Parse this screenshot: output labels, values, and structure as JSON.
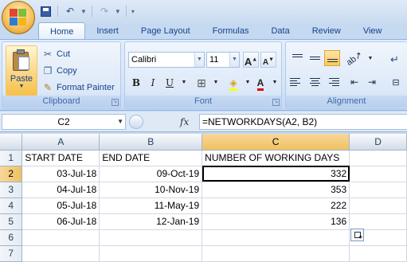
{
  "ribbon": {
    "tabs": [
      "Home",
      "Insert",
      "Page Layout",
      "Formulas",
      "Data",
      "Review",
      "View"
    ],
    "clipboard": {
      "paste": "Paste",
      "cut": "Cut",
      "copy": "Copy",
      "format_painter": "Format Painter",
      "label": "Clipboard"
    },
    "font": {
      "name": "Calibri",
      "size": "11",
      "label": "Font"
    },
    "alignment": {
      "label": "Alignment"
    }
  },
  "formula_bar": {
    "name_box": "C2",
    "fx": "fx",
    "formula": "=NETWORKDAYS(A2, B2)"
  },
  "sheet": {
    "columns": [
      "A",
      "B",
      "C",
      "D"
    ],
    "selected_column": "C",
    "selected_row": "2",
    "rows": [
      {
        "num": "1",
        "a": "START DATE",
        "b": "END DATE",
        "c": "NUMBER OF WORKING DAYS",
        "d": ""
      },
      {
        "num": "2",
        "a": "03-Jul-18",
        "b": "09-Oct-19",
        "c": "332",
        "d": ""
      },
      {
        "num": "3",
        "a": "04-Jul-18",
        "b": "10-Nov-19",
        "c": "353",
        "d": ""
      },
      {
        "num": "4",
        "a": "05-Jul-18",
        "b": "11-May-19",
        "c": "222",
        "d": ""
      },
      {
        "num": "5",
        "a": "06-Jul-18",
        "b": "12-Jan-19",
        "c": "136",
        "d": ""
      },
      {
        "num": "6",
        "a": "",
        "b": "",
        "c": "",
        "d": ""
      },
      {
        "num": "7",
        "a": "",
        "b": "",
        "c": "",
        "d": ""
      }
    ]
  }
}
